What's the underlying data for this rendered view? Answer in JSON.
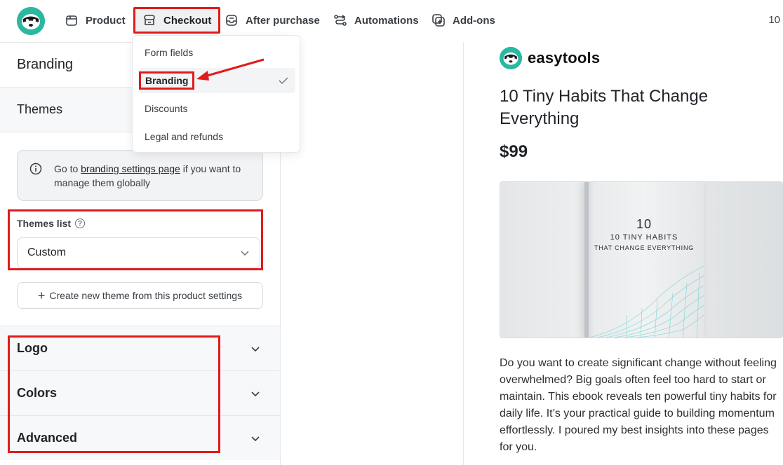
{
  "nav": {
    "items": [
      {
        "label": "Product",
        "icon": "box-icon"
      },
      {
        "label": "Checkout",
        "icon": "store-icon"
      },
      {
        "label": "After purchase",
        "icon": "inbox-icon"
      },
      {
        "label": "Automations",
        "icon": "flow-icon"
      },
      {
        "label": "Add-ons",
        "icon": "plus-square-icon"
      }
    ],
    "right_text": "10"
  },
  "dropdown": {
    "items": [
      "Form fields",
      "Branding",
      "Discounts",
      "Legal and refunds"
    ],
    "selected": "Branding"
  },
  "left": {
    "heading": "Branding",
    "themes_heading": "Themes",
    "info": {
      "prefix": "Go to ",
      "link": "branding settings page",
      "suffix": " if you want to manage them globally"
    },
    "themes_list_label": "Themes list",
    "themes_help": "?",
    "themes_selected": "Custom",
    "create_button": "Create new theme from this product settings",
    "create_plus": "+",
    "sections": [
      "Logo",
      "Colors",
      "Advanced"
    ]
  },
  "preview": {
    "brand_name": "easytools",
    "title": "10 Tiny Habits That Change Everything",
    "price": "$99",
    "cover": {
      "number": "10",
      "line1": "10 TINY HABITS",
      "line2": "THAT CHANGE EVERYTHING"
    },
    "description": "Do you want to create significant change without feeling overwhelmed? Big goals often feel too hard to start or maintain. This ebook reveals ten powerful tiny habits for daily life. It’s your practical guide to building momentum effortlessly. I poured my best insights into these pages for you."
  },
  "colors": {
    "accent_red": "#e01b1b",
    "brand_teal": "#2bb8a0"
  }
}
